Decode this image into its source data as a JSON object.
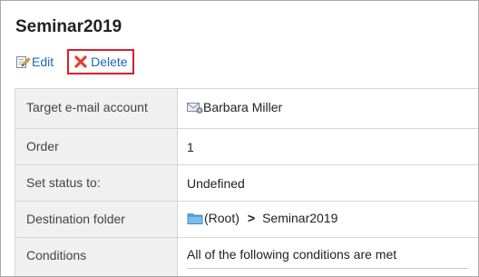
{
  "page": {
    "title": "Seminar2019"
  },
  "toolbar": {
    "edit_label": "Edit",
    "delete_label": "Delete"
  },
  "details": {
    "target_account": {
      "label": "Target e-mail account",
      "value": "Barbara Miller",
      "icon": "mail-account-icon"
    },
    "order": {
      "label": "Order",
      "value": "1"
    },
    "status": {
      "label": "Set status to:",
      "value": "Undefined"
    },
    "destination": {
      "label": "Destination folder",
      "root": "(Root)",
      "separator": ">",
      "folder": "Seminar2019",
      "icon": "folder-icon"
    },
    "conditions": {
      "label": "Conditions",
      "value": "All of the following conditions are met"
    }
  },
  "colors": {
    "link": "#1a6ab8",
    "delete_highlight": "#d9202a",
    "label_bg": "#f0f0f0",
    "border": "#d6d6d6",
    "folder": "#5aa7e0"
  }
}
